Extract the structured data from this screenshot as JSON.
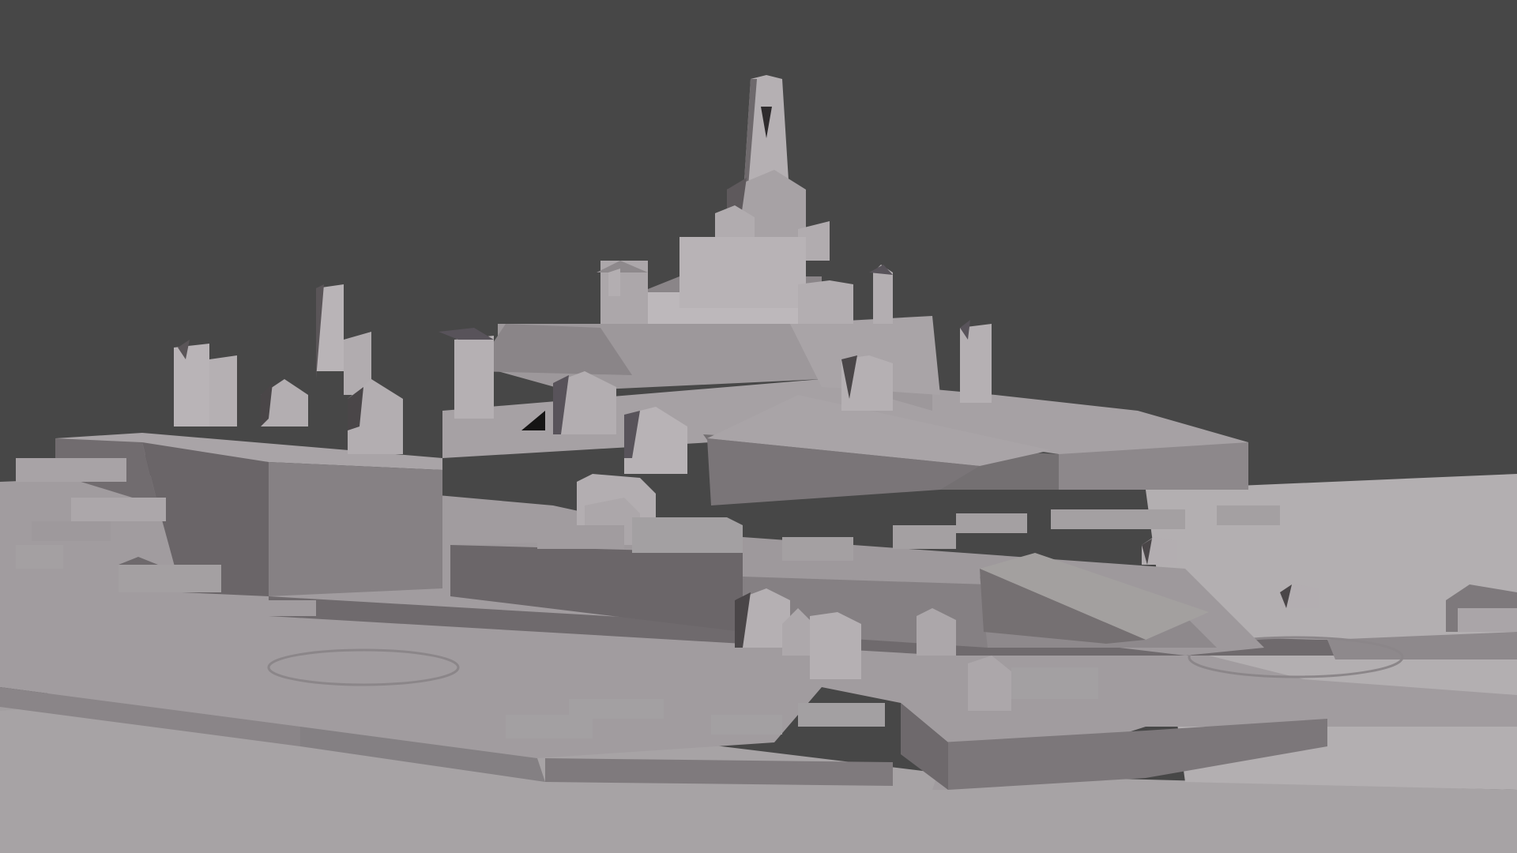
{
  "scene": {
    "subject": "untextured-3d-model-of-hilltop-city",
    "render_style": "clay-grey-solid-shading",
    "colors": {
      "background": "#474747",
      "ground": "#a7a3a5",
      "ground_far": "#b3afb1",
      "surface_top": "#a19c9f",
      "cliff_side": "#7e797c",
      "cliff_shadow": "#6c676a",
      "roof_light": "#aaa5a8",
      "roof_dark": "#615c5f",
      "wall_light": "#bdb8bb",
      "window_dark": "#4a4648",
      "black_gap": "#151414"
    }
  }
}
